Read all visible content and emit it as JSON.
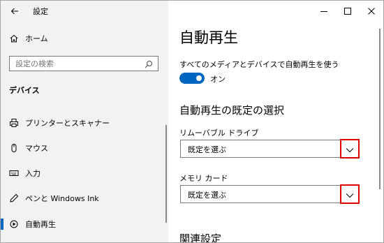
{
  "app": {
    "title": "設定"
  },
  "sidebar": {
    "home_label": "ホーム",
    "search": {
      "placeholder": "設定の検索"
    },
    "section_heading": "デバイス",
    "items": [
      {
        "label": "プリンターとスキャナー",
        "icon": "printer-icon"
      },
      {
        "label": "マウス",
        "icon": "mouse-icon"
      },
      {
        "label": "入力",
        "icon": "keyboard-icon"
      },
      {
        "label": "ペンと Windows Ink",
        "icon": "pen-icon"
      },
      {
        "label": "自動再生",
        "icon": "autoplay-icon",
        "active": true
      }
    ]
  },
  "main": {
    "title": "自動再生",
    "toggle": {
      "description": "すべてのメディアとデバイスで自動再生を使う",
      "state_label": "オン",
      "on": true
    },
    "defaults_heading": "自動再生の既定の選択",
    "removable_drive": {
      "label": "リムーバブル ドライブ",
      "value": "既定を選ぶ"
    },
    "memory_card": {
      "label": "メモリ カード",
      "value": "既定を選ぶ"
    },
    "related_heading": "関連設定"
  },
  "colors": {
    "accent": "#0067c0",
    "highlight": "#e00000",
    "sidebar_bg": "#f2f2f2"
  }
}
